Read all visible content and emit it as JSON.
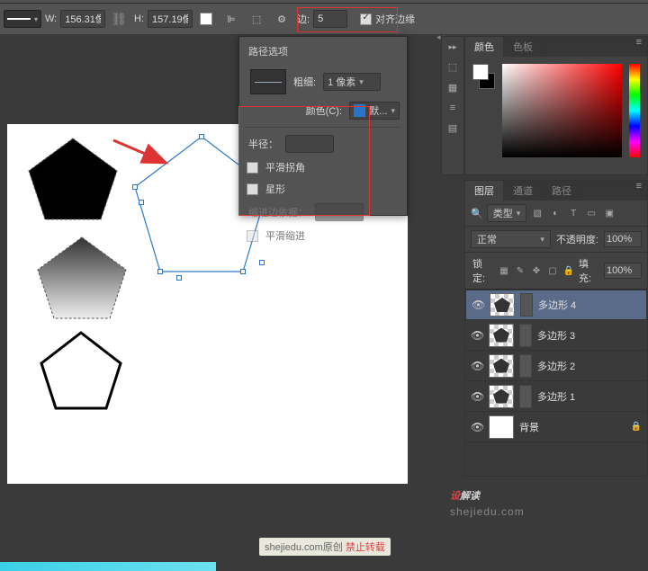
{
  "options_bar": {
    "w_label": "W:",
    "w_value": "156.31像",
    "h_label": "H:",
    "h_value": "157.19像",
    "sides_label": "边:",
    "sides_value": "5",
    "align_edges": "对齐边缘"
  },
  "path_popup": {
    "title": "路径选项",
    "thickness_label": "粗细:",
    "thickness_value": "1 像素",
    "color_label": "颜色(C):",
    "color_value": "默...",
    "radius_label": "半径：",
    "smooth_corners": "平滑拐角",
    "star": "星形",
    "indent_label": "缩进边依据：",
    "smooth_indent": "平滑缩进"
  },
  "panels": {
    "color_tab": "颜色",
    "swatch_tab": "色板",
    "layers_tab": "图层",
    "channels_tab": "通道",
    "paths_tab": "路径"
  },
  "layers": {
    "filter_type": "类型",
    "blend_mode": "正常",
    "opacity_label": "不透明度:",
    "opacity_value": "100%",
    "lock_label": "锁定:",
    "fill_label": "填充:",
    "fill_value": "100%",
    "items": [
      {
        "name": "多边形 4"
      },
      {
        "name": "多边形 3"
      },
      {
        "name": "多边形 2"
      },
      {
        "name": "多边形 1"
      },
      {
        "name": "背景"
      }
    ]
  },
  "watermark": {
    "text": "解读",
    "prefix": "设",
    "url": "shejiedu.com"
  },
  "bottom": {
    "grey": "shejiedu.com原创",
    "red": "禁止转载"
  },
  "icons": {
    "gear": "gear-icon",
    "chain": "link-chain-icon",
    "align": "align-icon",
    "search": "magnifier-icon"
  }
}
